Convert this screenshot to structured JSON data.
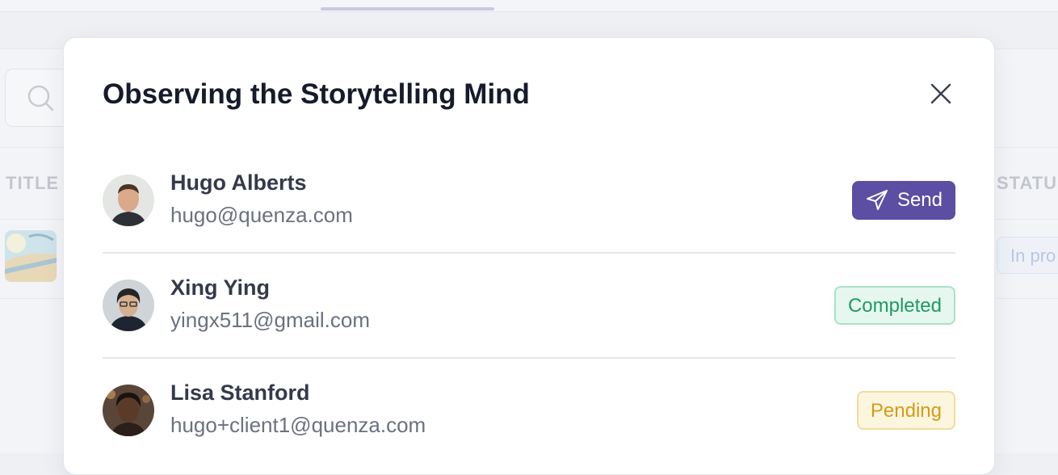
{
  "background": {
    "columns": {
      "title": "TITLE",
      "status": "STATU"
    },
    "row_status": "In pro"
  },
  "modal": {
    "title": "Observing the Storytelling Mind",
    "participants": [
      {
        "name": "Hugo Alberts",
        "email": "hugo@quenza.com",
        "action": "Send"
      },
      {
        "name": "Xing Ying",
        "email": "yingx511@gmail.com",
        "status": "Completed"
      },
      {
        "name": "Lisa Stanford",
        "email": "hugo+client1@quenza.com",
        "status": "Pending"
      }
    ]
  },
  "colors": {
    "send_button": "#5b4ea3",
    "completed": "#1f9a63",
    "pending": "#d69a18"
  }
}
